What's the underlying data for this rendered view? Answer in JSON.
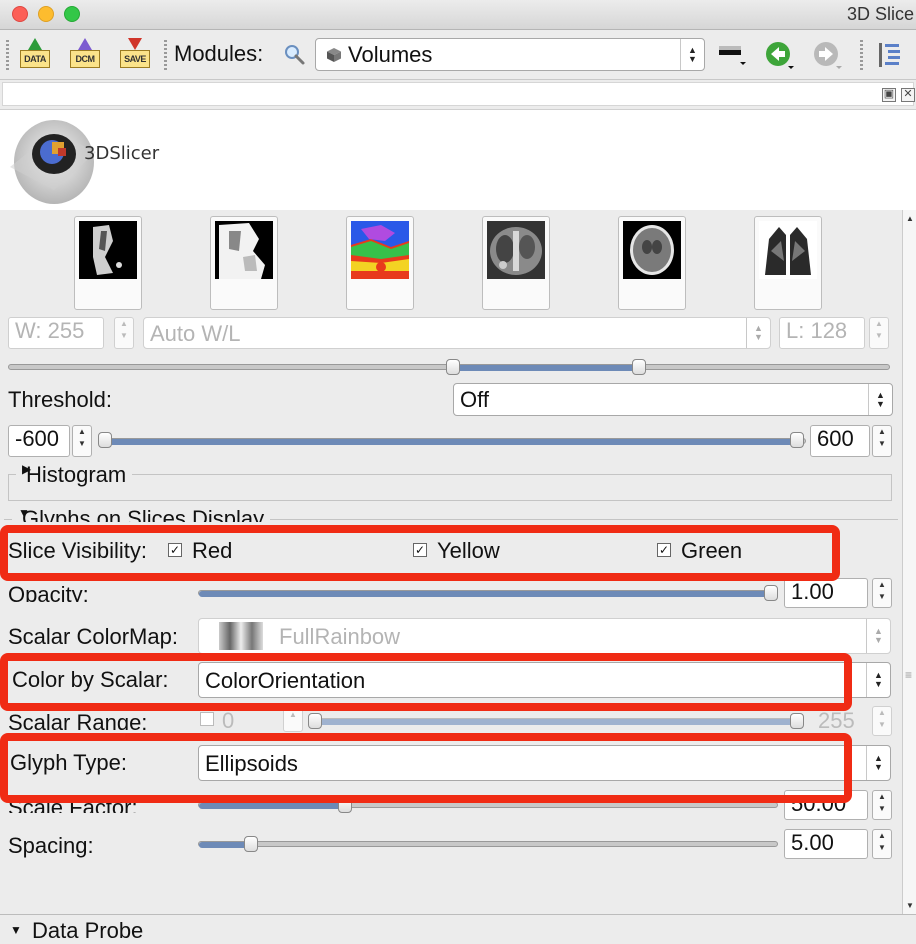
{
  "window": {
    "title": "3D Slice"
  },
  "toolbar": {
    "data_label": "DATA",
    "dcm_label": "DCM",
    "save_label": "SAVE",
    "modules_label": "Modules:",
    "module_selected": "Volumes"
  },
  "logo": {
    "text": "3DSlicer"
  },
  "window_level": {
    "window_value": "W: 255",
    "preset": "Auto W/L",
    "level_value": "L: 128"
  },
  "threshold": {
    "label": "Threshold:",
    "mode": "Off",
    "min_value": "-600",
    "max_value": "600"
  },
  "histogram": {
    "label": "Histogram"
  },
  "glyphs": {
    "section_title": "Glyphs on Slices Display",
    "slice_visibility_label": "Slice Visibility:",
    "red_label": "Red",
    "yellow_label": "Yellow",
    "green_label": "Green",
    "red_checked": true,
    "yellow_checked": true,
    "green_checked": true,
    "opacity_label": "Opacity:",
    "opacity_value": "1.00",
    "opacity_fraction": 1.0,
    "colormap_label": "Scalar ColorMap:",
    "colormap_value": "FullRainbow",
    "color_by_label": "Color by Scalar:",
    "color_by_value": "ColorOrientation",
    "scalar_range_label": "Scalar Range:",
    "scalar_range_min": "0",
    "scalar_range_max": "255",
    "glyph_type_label": "Glyph Type:",
    "glyph_type_value": "Ellipsoids",
    "scale_factor_label": "Scale Factor:",
    "scale_factor_value": "50.00",
    "spacing_label": "Spacing:",
    "spacing_value": "5.00"
  },
  "data_probe": {
    "label": "Data Probe"
  },
  "colors": {
    "highlight": "#f02b14",
    "slider_fill": "#6d8ab7"
  }
}
